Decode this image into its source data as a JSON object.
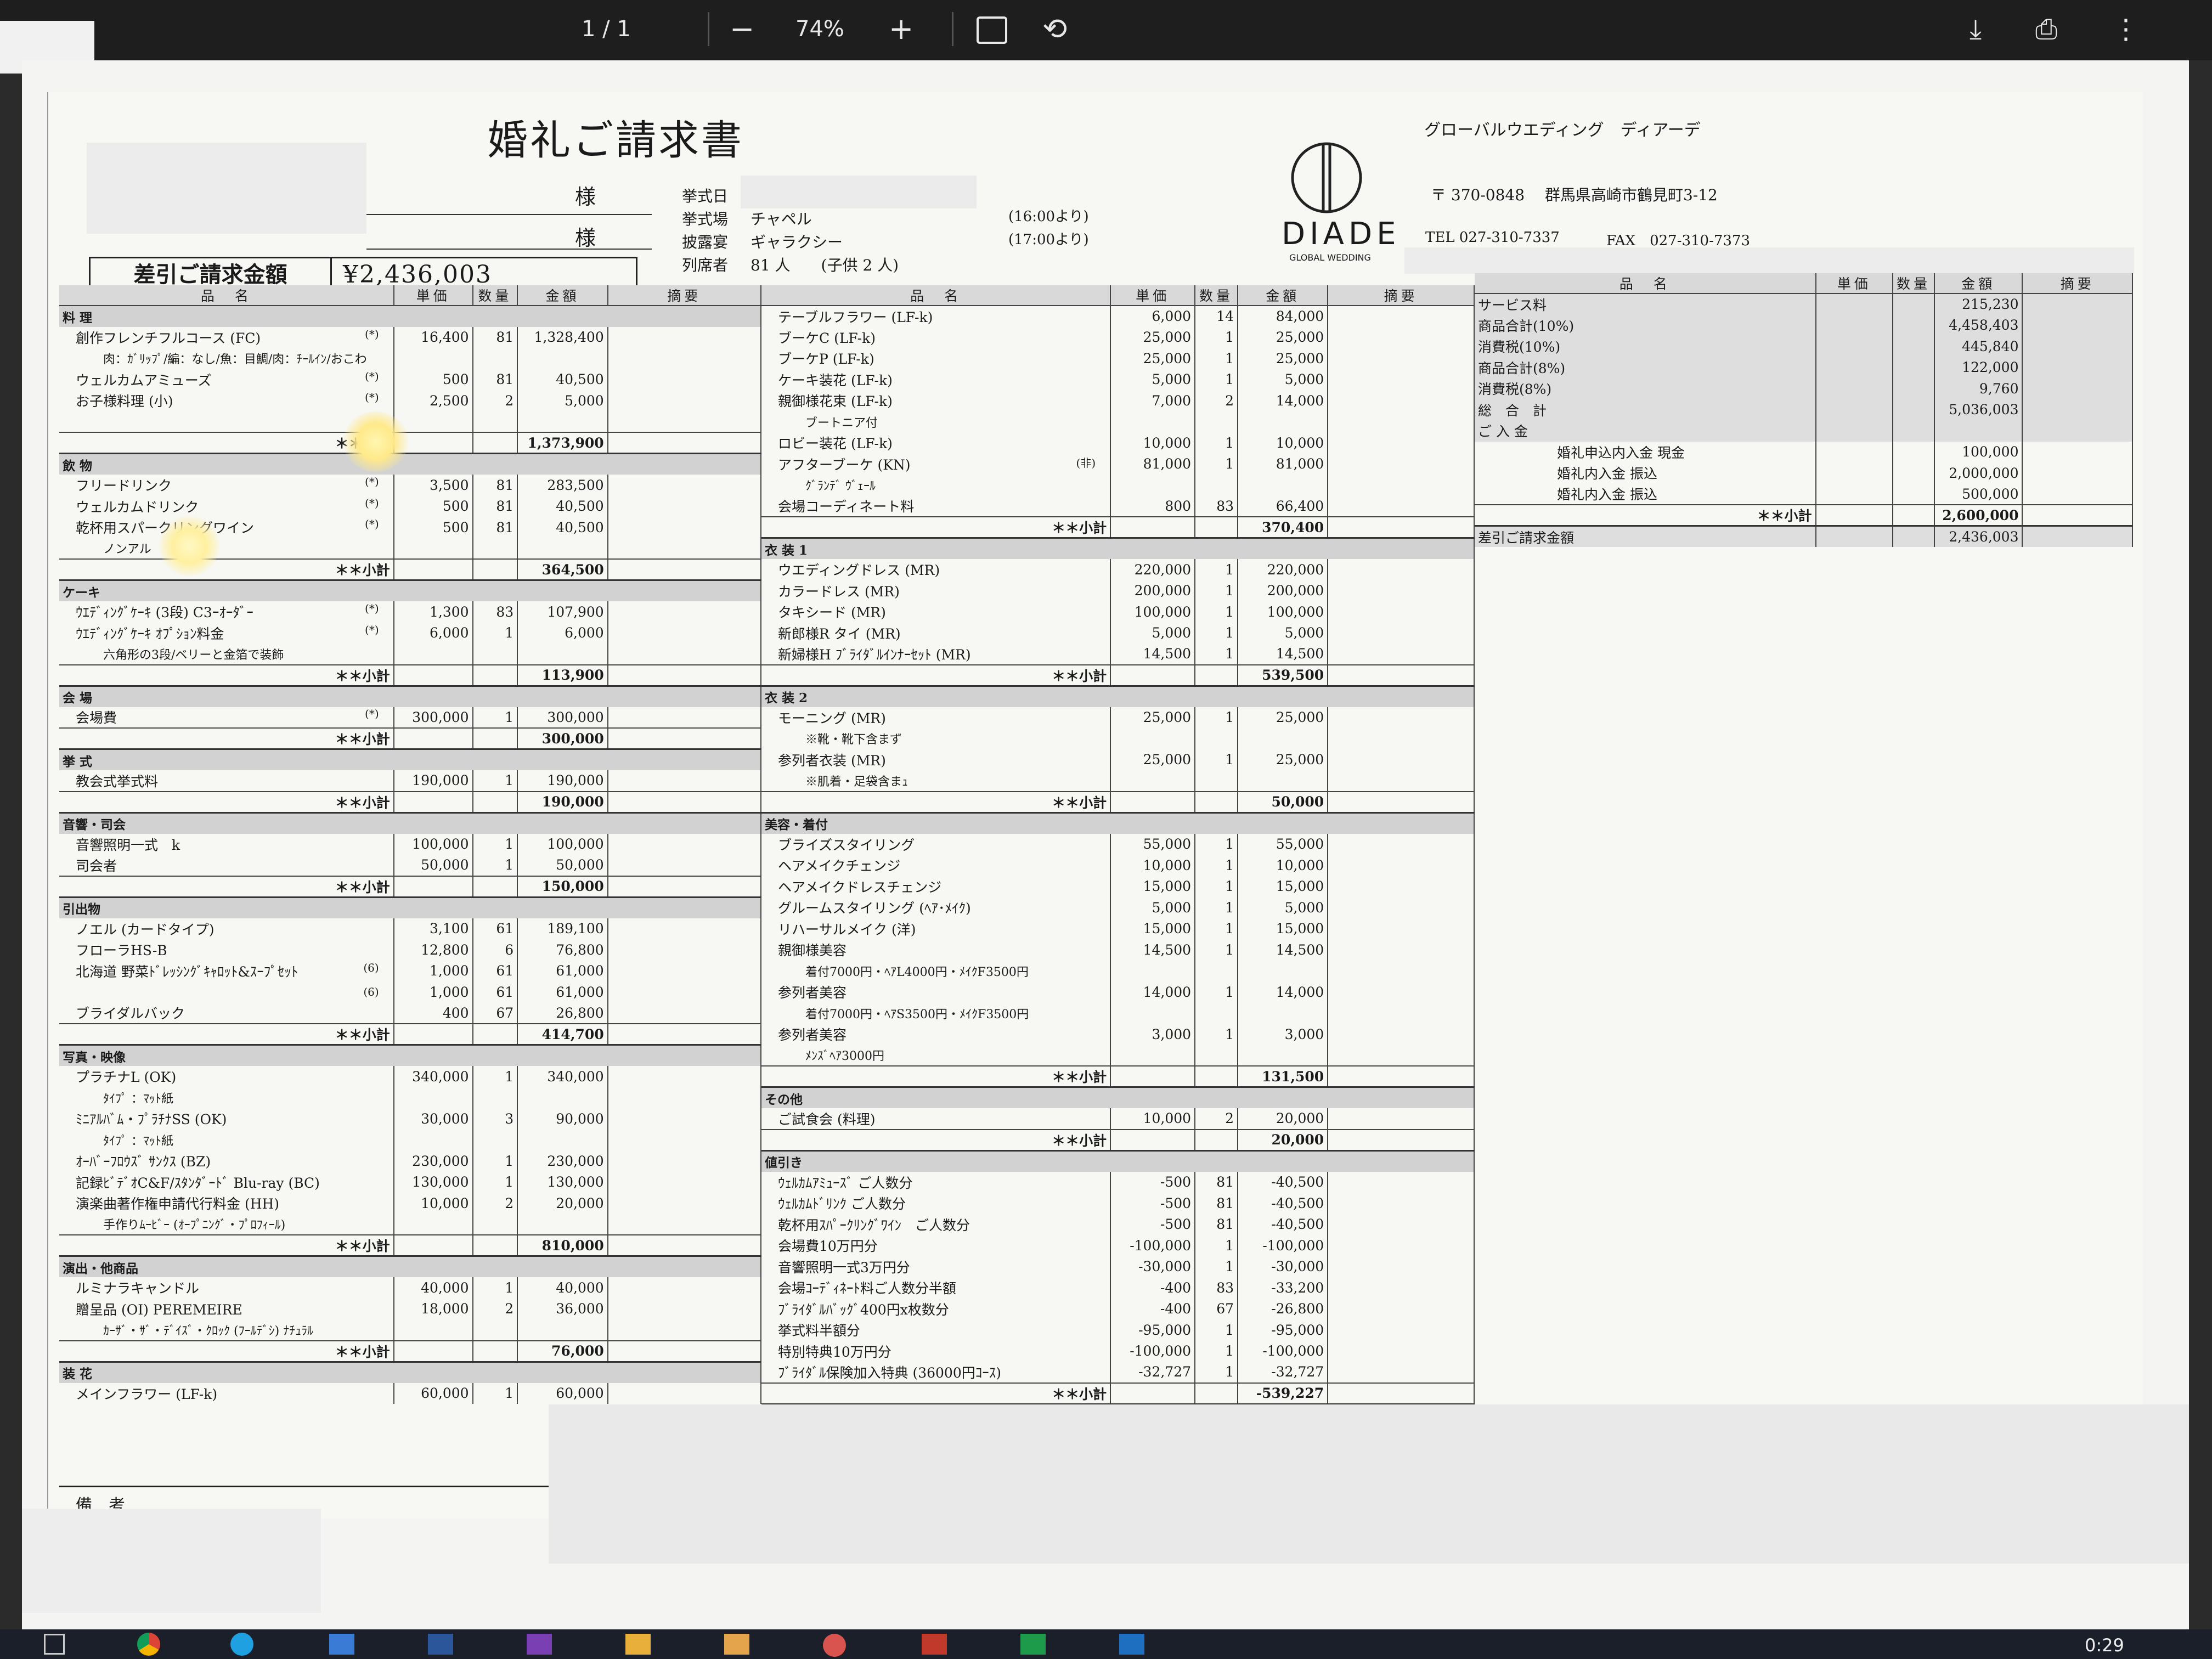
{
  "viewer": {
    "page_indicator": "1 / 1",
    "zoom": "74%",
    "clock": "0:29"
  },
  "doc": {
    "title": "婚礼ご請求書",
    "sama1": "様",
    "sama2": "様",
    "info": [
      {
        "label": "挙式日",
        "value": "",
        "time": ""
      },
      {
        "label": "挙式場",
        "value": "チャペル",
        "time": "(16:00より)"
      },
      {
        "label": "披露宴",
        "value": "ギャラクシー",
        "time": "(17:00より)"
      },
      {
        "label": "列席者",
        "value": "81 人　　(子供 2 人)",
        "time": ""
      }
    ],
    "amount_label": "差引ご請求金額",
    "amount_value": "¥2,436,003",
    "company_name": "グローバルウエディング　ディアーデ",
    "logo_text": "DIADE",
    "logo_sub": "GLOBAL WEDDING",
    "address": "〒 370-0848　 群馬県高崎市鶴見町3-12",
    "tel": "TEL 027-310-7337",
    "fax": "FAX　027-310-7373",
    "remarks_label": "備　考",
    "headers": {
      "name": "品　名",
      "unit": "単価",
      "qty": "数量",
      "amount": "金額",
      "note": "摘要"
    }
  },
  "col1": [
    {
      "t": "sec",
      "name": "料 理"
    },
    {
      "t": "item",
      "name": "創作フレンチフルコース (FC)",
      "mark": "(*)",
      "unit": "16,400",
      "qty": "81",
      "amount": "1,328,400"
    },
    {
      "t": "note",
      "name": "肉：ｶﾞﾘｯﾌﾟ/編：なし/魚：目鯛/肉：ﾁｰﾙｲﾝ/おこわ"
    },
    {
      "t": "item",
      "name": "ウェルカムアミューズ",
      "mark": "(*)",
      "unit": "500",
      "qty": "81",
      "amount": "40,500"
    },
    {
      "t": "item",
      "name": "お子様料理 (小)",
      "mark": "(*)",
      "unit": "2,500",
      "qty": "2",
      "amount": "5,000"
    },
    {
      "t": "blank"
    },
    {
      "t": "sub",
      "name": "＊＊小計",
      "amount": "1,373,900"
    },
    {
      "t": "sec",
      "name": "飲 物"
    },
    {
      "t": "item",
      "name": "フリードリンク",
      "mark": "(*)",
      "unit": "3,500",
      "qty": "81",
      "amount": "283,500"
    },
    {
      "t": "item",
      "name": "ウェルカムドリンク",
      "mark": "(*)",
      "unit": "500",
      "qty": "81",
      "amount": "40,500"
    },
    {
      "t": "item",
      "name": "乾杯用スパークリングワイン",
      "mark": "(*)",
      "unit": "500",
      "qty": "81",
      "amount": "40,500"
    },
    {
      "t": "note",
      "name": "ノンアル"
    },
    {
      "t": "sub",
      "name": "＊＊小計",
      "amount": "364,500"
    },
    {
      "t": "sec",
      "name": "ケーキ"
    },
    {
      "t": "item",
      "name": "ｳｴﾃﾞｨﾝｸﾞｹｰｷ (3段) C3ｰｵｰﾀﾞｰ",
      "mark": "(*)",
      "unit": "1,300",
      "qty": "83",
      "amount": "107,900"
    },
    {
      "t": "item",
      "name": "ｳｴﾃﾞｨﾝｸﾞｹｰｷ ｵﾌﾟｼｮﾝ料金",
      "mark": "(*)",
      "unit": "6,000",
      "qty": "1",
      "amount": "6,000"
    },
    {
      "t": "note",
      "name": "六角形の3段/ベリーと金箔で装飾"
    },
    {
      "t": "sub",
      "name": "＊＊小計",
      "amount": "113,900"
    },
    {
      "t": "sec",
      "name": "会 場"
    },
    {
      "t": "item",
      "name": "会場費",
      "mark": "(*)",
      "unit": "300,000",
      "qty": "1",
      "amount": "300,000"
    },
    {
      "t": "sub",
      "name": "＊＊小計",
      "amount": "300,000"
    },
    {
      "t": "sec",
      "name": "挙 式"
    },
    {
      "t": "item",
      "name": "教会式挙式料",
      "mark": "",
      "unit": "190,000",
      "qty": "1",
      "amount": "190,000"
    },
    {
      "t": "sub",
      "name": "＊＊小計",
      "amount": "190,000"
    },
    {
      "t": "sec",
      "name": "音響・司会"
    },
    {
      "t": "item",
      "name": "音響照明一式　k",
      "mark": "",
      "unit": "100,000",
      "qty": "1",
      "amount": "100,000"
    },
    {
      "t": "item",
      "name": "司会者",
      "mark": "",
      "unit": "50,000",
      "qty": "1",
      "amount": "50,000"
    },
    {
      "t": "sub",
      "name": "＊＊小計",
      "amount": "150,000"
    },
    {
      "t": "sec",
      "name": "引出物"
    },
    {
      "t": "item",
      "name": "ノエル (カードタイプ)",
      "mark": "",
      "unit": "3,100",
      "qty": "61",
      "amount": "189,100"
    },
    {
      "t": "item",
      "name": "フローラHS-B",
      "mark": "",
      "unit": "12,800",
      "qty": "6",
      "amount": "76,800"
    },
    {
      "t": "item",
      "name": "北海道 野菜ﾄﾞﾚｯｼﾝｸﾞｷｬﾛｯﾄ&ｽｰﾌﾟｾｯﾄ",
      "mark": "(6)",
      "unit": "1,000",
      "qty": "61",
      "amount": "61,000"
    },
    {
      "t": "item",
      "name": "",
      "mark": "(6)",
      "unit": "1,000",
      "qty": "61",
      "amount": "61,000"
    },
    {
      "t": "item",
      "name": "ブライダルバック",
      "mark": "",
      "unit": "400",
      "qty": "67",
      "amount": "26,800"
    },
    {
      "t": "sub",
      "name": "＊＊小計",
      "amount": "414,700"
    },
    {
      "t": "sec",
      "name": "写真・映像"
    },
    {
      "t": "item",
      "name": "プラチナL (OK)",
      "mark": "",
      "unit": "340,000",
      "qty": "1",
      "amount": "340,000"
    },
    {
      "t": "note",
      "name": "ﾀｲﾌﾟ ：ﾏｯﾄ紙"
    },
    {
      "t": "item",
      "name": "ﾐﾆｱﾙﾊﾞﾑ・ﾌﾟﾗﾁﾅSS (OK)",
      "mark": "",
      "unit": "30,000",
      "qty": "3",
      "amount": "90,000"
    },
    {
      "t": "note",
      "name": "ﾀｲﾌﾟ ：ﾏｯﾄ紙"
    },
    {
      "t": "item",
      "name": "ｵｰﾊﾞｰﾌﾛｳｽﾞ ｻﾝｸｽ (BZ)",
      "mark": "",
      "unit": "230,000",
      "qty": "1",
      "amount": "230,000"
    },
    {
      "t": "item",
      "name": "記録ﾋﾞﾃﾞｵC&F/ｽﾀﾝﾀﾞｰﾄﾞ Blu-ray (BC)",
      "mark": "",
      "unit": "130,000",
      "qty": "1",
      "amount": "130,000"
    },
    {
      "t": "item",
      "name": "演楽曲著作権申請代行料金 (HH)",
      "mark": "",
      "unit": "10,000",
      "qty": "2",
      "amount": "20,000"
    },
    {
      "t": "note",
      "name": "手作りﾑｰﾋﾞｰ (ｵｰﾌﾟﾆﾝｸﾞ・ﾌﾟﾛﾌｨｰﾙ)"
    },
    {
      "t": "sub",
      "name": "＊＊小計",
      "amount": "810,000"
    },
    {
      "t": "sec",
      "name": "演出・他商品"
    },
    {
      "t": "item",
      "name": "ルミナラキャンドル",
      "mark": "",
      "unit": "40,000",
      "qty": "1",
      "amount": "40,000"
    },
    {
      "t": "item",
      "name": "贈呈品 (OI) PEREMEIRE",
      "mark": "",
      "unit": "18,000",
      "qty": "2",
      "amount": "36,000"
    },
    {
      "t": "note",
      "name": "ｶｰｻﾞ・ｻﾞ・ﾃﾞｲｽﾞ・ｸﾛｯｸ (ﾌｰﾙﾃﾞｼ) ﾅﾁｭﾗﾙ"
    },
    {
      "t": "sub",
      "name": "＊＊小計",
      "amount": "76,000"
    },
    {
      "t": "sec",
      "name": "装 花"
    },
    {
      "t": "item",
      "name": "メインフラワー (LF-k)",
      "mark": "",
      "unit": "60,000",
      "qty": "1",
      "amount": "60,000"
    }
  ],
  "col2": [
    {
      "t": "item",
      "name": "テーブルフラワー (LF-k)",
      "mark": "",
      "unit": "6,000",
      "qty": "14",
      "amount": "84,000"
    },
    {
      "t": "item",
      "name": "ブーケC (LF-k)",
      "mark": "",
      "unit": "25,000",
      "qty": "1",
      "amount": "25,000"
    },
    {
      "t": "item",
      "name": "ブーケP (LF-k)",
      "mark": "",
      "unit": "25,000",
      "qty": "1",
      "amount": "25,000"
    },
    {
      "t": "item",
      "name": "ケーキ装花 (LF-k)",
      "mark": "",
      "unit": "5,000",
      "qty": "1",
      "amount": "5,000"
    },
    {
      "t": "item",
      "name": "親御様花束 (LF-k)",
      "mark": "",
      "unit": "7,000",
      "qty": "2",
      "amount": "14,000"
    },
    {
      "t": "note",
      "name": "ブートニア付"
    },
    {
      "t": "item",
      "name": "ロビー装花 (LF-k)",
      "mark": "",
      "unit": "10,000",
      "qty": "1",
      "amount": "10,000"
    },
    {
      "t": "item",
      "name": "アフターブーケ (KN)",
      "mark": "(非)",
      "unit": "81,000",
      "qty": "1",
      "amount": "81,000"
    },
    {
      "t": "note",
      "name": "ｸﾞﾗﾝﾃﾞ ｳﾞｪｰﾙ"
    },
    {
      "t": "item",
      "name": "会場コーディネート料",
      "mark": "",
      "unit": "800",
      "qty": "83",
      "amount": "66,400"
    },
    {
      "t": "sub",
      "name": "＊＊小計",
      "amount": "370,400"
    },
    {
      "t": "sec",
      "name": "衣 装 1"
    },
    {
      "t": "item",
      "name": "ウエディングドレス (MR)",
      "mark": "",
      "unit": "220,000",
      "qty": "1",
      "amount": "220,000"
    },
    {
      "t": "item",
      "name": "カラードレス (MR)",
      "mark": "",
      "unit": "200,000",
      "qty": "1",
      "amount": "200,000"
    },
    {
      "t": "item",
      "name": "タキシード (MR)",
      "mark": "",
      "unit": "100,000",
      "qty": "1",
      "amount": "100,000"
    },
    {
      "t": "item",
      "name": "新郎様R タイ (MR)",
      "mark": "",
      "unit": "5,000",
      "qty": "1",
      "amount": "5,000"
    },
    {
      "t": "item",
      "name": "新婦様H ﾌﾞﾗｲﾀﾞﾙｲﾝﾅｰｾｯﾄ (MR)",
      "mark": "",
      "unit": "14,500",
      "qty": "1",
      "amount": "14,500"
    },
    {
      "t": "sub",
      "name": "＊＊小計",
      "amount": "539,500"
    },
    {
      "t": "sec",
      "name": "衣 装 2"
    },
    {
      "t": "item",
      "name": "モーニング (MR)",
      "mark": "",
      "unit": "25,000",
      "qty": "1",
      "amount": "25,000"
    },
    {
      "t": "note",
      "name": "※靴・靴下含まず"
    },
    {
      "t": "item",
      "name": "参列者衣装 (MR)",
      "mark": "",
      "unit": "25,000",
      "qty": "1",
      "amount": "25,000"
    },
    {
      "t": "note",
      "name": "※肌着・足袋含まｭ"
    },
    {
      "t": "sub",
      "name": "＊＊小計",
      "amount": "50,000"
    },
    {
      "t": "sec",
      "name": "美容・着付"
    },
    {
      "t": "item",
      "name": "ブライズスタイリング",
      "mark": "",
      "unit": "55,000",
      "qty": "1",
      "amount": "55,000"
    },
    {
      "t": "item",
      "name": "ヘアメイクチェンジ",
      "mark": "",
      "unit": "10,000",
      "qty": "1",
      "amount": "10,000"
    },
    {
      "t": "item",
      "name": "ヘアメイクドレスチェンジ",
      "mark": "",
      "unit": "15,000",
      "qty": "1",
      "amount": "15,000"
    },
    {
      "t": "item",
      "name": "グルームスタイリング (ﾍｱ･ﾒｲｸ)",
      "mark": "",
      "unit": "5,000",
      "qty": "1",
      "amount": "5,000"
    },
    {
      "t": "item",
      "name": "リハーサルメイク (洋)",
      "mark": "",
      "unit": "15,000",
      "qty": "1",
      "amount": "15,000"
    },
    {
      "t": "item",
      "name": "親御様美容",
      "mark": "",
      "unit": "14,500",
      "qty": "1",
      "amount": "14,500"
    },
    {
      "t": "note",
      "name": "着付7000円・ﾍｱL4000円・ﾒｲｸF3500円"
    },
    {
      "t": "item",
      "name": "参列者美容",
      "mark": "",
      "unit": "14,000",
      "qty": "1",
      "amount": "14,000"
    },
    {
      "t": "note",
      "name": "着付7000円・ﾍｱS3500円・ﾒｲｸF3500円"
    },
    {
      "t": "item",
      "name": "参列者美容",
      "mark": "",
      "unit": "3,000",
      "qty": "1",
      "amount": "3,000"
    },
    {
      "t": "note",
      "name": "ﾒﾝｽﾞﾍｱ3000円"
    },
    {
      "t": "sub",
      "name": "＊＊小計",
      "amount": "131,500"
    },
    {
      "t": "sec",
      "name": "その他"
    },
    {
      "t": "item",
      "name": "ご試食会 (料理)",
      "mark": "",
      "unit": "10,000",
      "qty": "2",
      "amount": "20,000"
    },
    {
      "t": "sub",
      "name": "＊＊小計",
      "amount": "20,000"
    },
    {
      "t": "sec",
      "name": "値引き"
    },
    {
      "t": "item",
      "name": "ｳｪﾙｶﾑｱﾐｭｰｽﾞ ご人数分",
      "mark": "",
      "unit": "-500",
      "qty": "81",
      "amount": "-40,500"
    },
    {
      "t": "item",
      "name": "ｳｪﾙｶﾑﾄﾞﾘﾝｸ ご人数分",
      "mark": "",
      "unit": "-500",
      "qty": "81",
      "amount": "-40,500"
    },
    {
      "t": "item",
      "name": "乾杯用ｽﾊﾟｰｸﾘﾝｸﾞﾜｲﾝ　ご人数分",
      "mark": "",
      "unit": "-500",
      "qty": "81",
      "amount": "-40,500"
    },
    {
      "t": "item",
      "name": "会場費10万円分",
      "mark": "",
      "unit": "-100,000",
      "qty": "1",
      "amount": "-100,000"
    },
    {
      "t": "item",
      "name": "音響照明一式3万円分",
      "mark": "",
      "unit": "-30,000",
      "qty": "1",
      "amount": "-30,000"
    },
    {
      "t": "item",
      "name": "会場ｺｰﾃﾞｨﾈｰﾄ料ご人数分半額",
      "mark": "",
      "unit": "-400",
      "qty": "83",
      "amount": "-33,200"
    },
    {
      "t": "item",
      "name": "ﾌﾞﾗｲﾀﾞﾙﾊﾞｯｸﾞ400円x枚数分",
      "mark": "",
      "unit": "-400",
      "qty": "67",
      "amount": "-26,800"
    },
    {
      "t": "item",
      "name": "挙式料半額分",
      "mark": "",
      "unit": "-95,000",
      "qty": "1",
      "amount": "-95,000"
    },
    {
      "t": "item",
      "name": "特別特典10万円分",
      "mark": "",
      "unit": "-100,000",
      "qty": "1",
      "amount": "-100,000"
    },
    {
      "t": "item",
      "name": "ﾌﾞﾗｲﾀﾞﾙ保険加入特典 (36000円ｺｰｽ)",
      "mark": "",
      "unit": "-32,727",
      "qty": "1",
      "amount": "-32,727"
    },
    {
      "t": "sub",
      "name": "＊＊小計",
      "amount": "-539,227"
    }
  ],
  "col3": [
    {
      "t": "tot",
      "name": "サービス料",
      "amount": "215,230"
    },
    {
      "t": "tot",
      "name": "商品合計(10%)",
      "amount": "4,458,403"
    },
    {
      "t": "tot",
      "name": "消費税(10%)",
      "amount": "445,840"
    },
    {
      "t": "tot",
      "name": "商品合計(8%)",
      "amount": "122,000"
    },
    {
      "t": "tot",
      "name": "消費税(8%)",
      "amount": "9,760"
    },
    {
      "t": "tot",
      "name": "総　合　計",
      "amount": "5,036,003"
    },
    {
      "t": "tot",
      "name": "ご 入 金",
      "amount": ""
    },
    {
      "t": "item",
      "name": "婚礼申込内入金 現金",
      "amount": "100,000"
    },
    {
      "t": "item",
      "name": "婚礼内入金 振込",
      "amount": "2,000,000"
    },
    {
      "t": "item",
      "name": "婚礼内入金 振込",
      "amount": "500,000"
    },
    {
      "t": "sub",
      "name": "＊＊小計",
      "amount": "2,600,000"
    },
    {
      "t": "tot",
      "name": "差引ご請求金額",
      "amount": "2,436,003"
    }
  ]
}
